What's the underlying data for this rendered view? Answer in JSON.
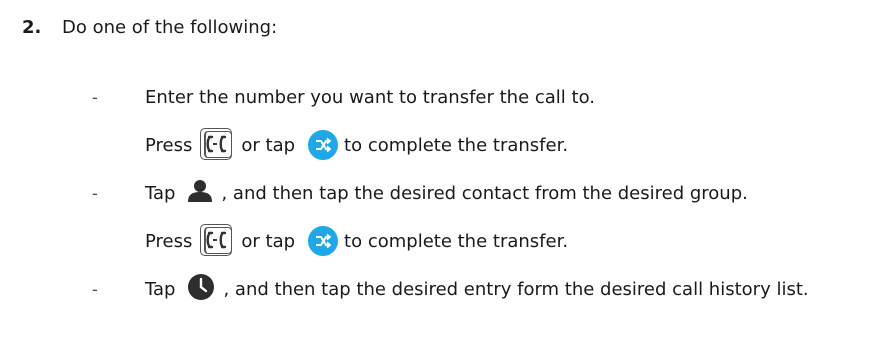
{
  "step": {
    "number": "2.",
    "intro": "Do one of the following:"
  },
  "options": [
    {
      "dash": "-",
      "text": "Enter the number you want to transfer the call to.",
      "press_line": {
        "press": "Press",
        "or_tap": "or tap",
        "tail": "to complete the transfer."
      }
    },
    {
      "dash": "-",
      "tap": "Tap",
      "tail": ", and then tap the desired contact from the desired group.",
      "press_line": {
        "press": "Press",
        "or_tap": "or tap",
        "tail": "to complete the transfer."
      }
    },
    {
      "dash": "-",
      "tap": "Tap",
      "tail": ", and then tap the desired entry form the desired call history list."
    }
  ],
  "icons": {
    "transfer_key": "transfer-hard-key-icon",
    "transfer_soft": "transfer-soft-button-icon",
    "contact": "contact-person-icon",
    "history": "call-history-clock-icon"
  },
  "colors": {
    "text": "#1a1a1a",
    "accent_blue": "#1ea8e8",
    "icon_dark": "#2e2e2e"
  }
}
